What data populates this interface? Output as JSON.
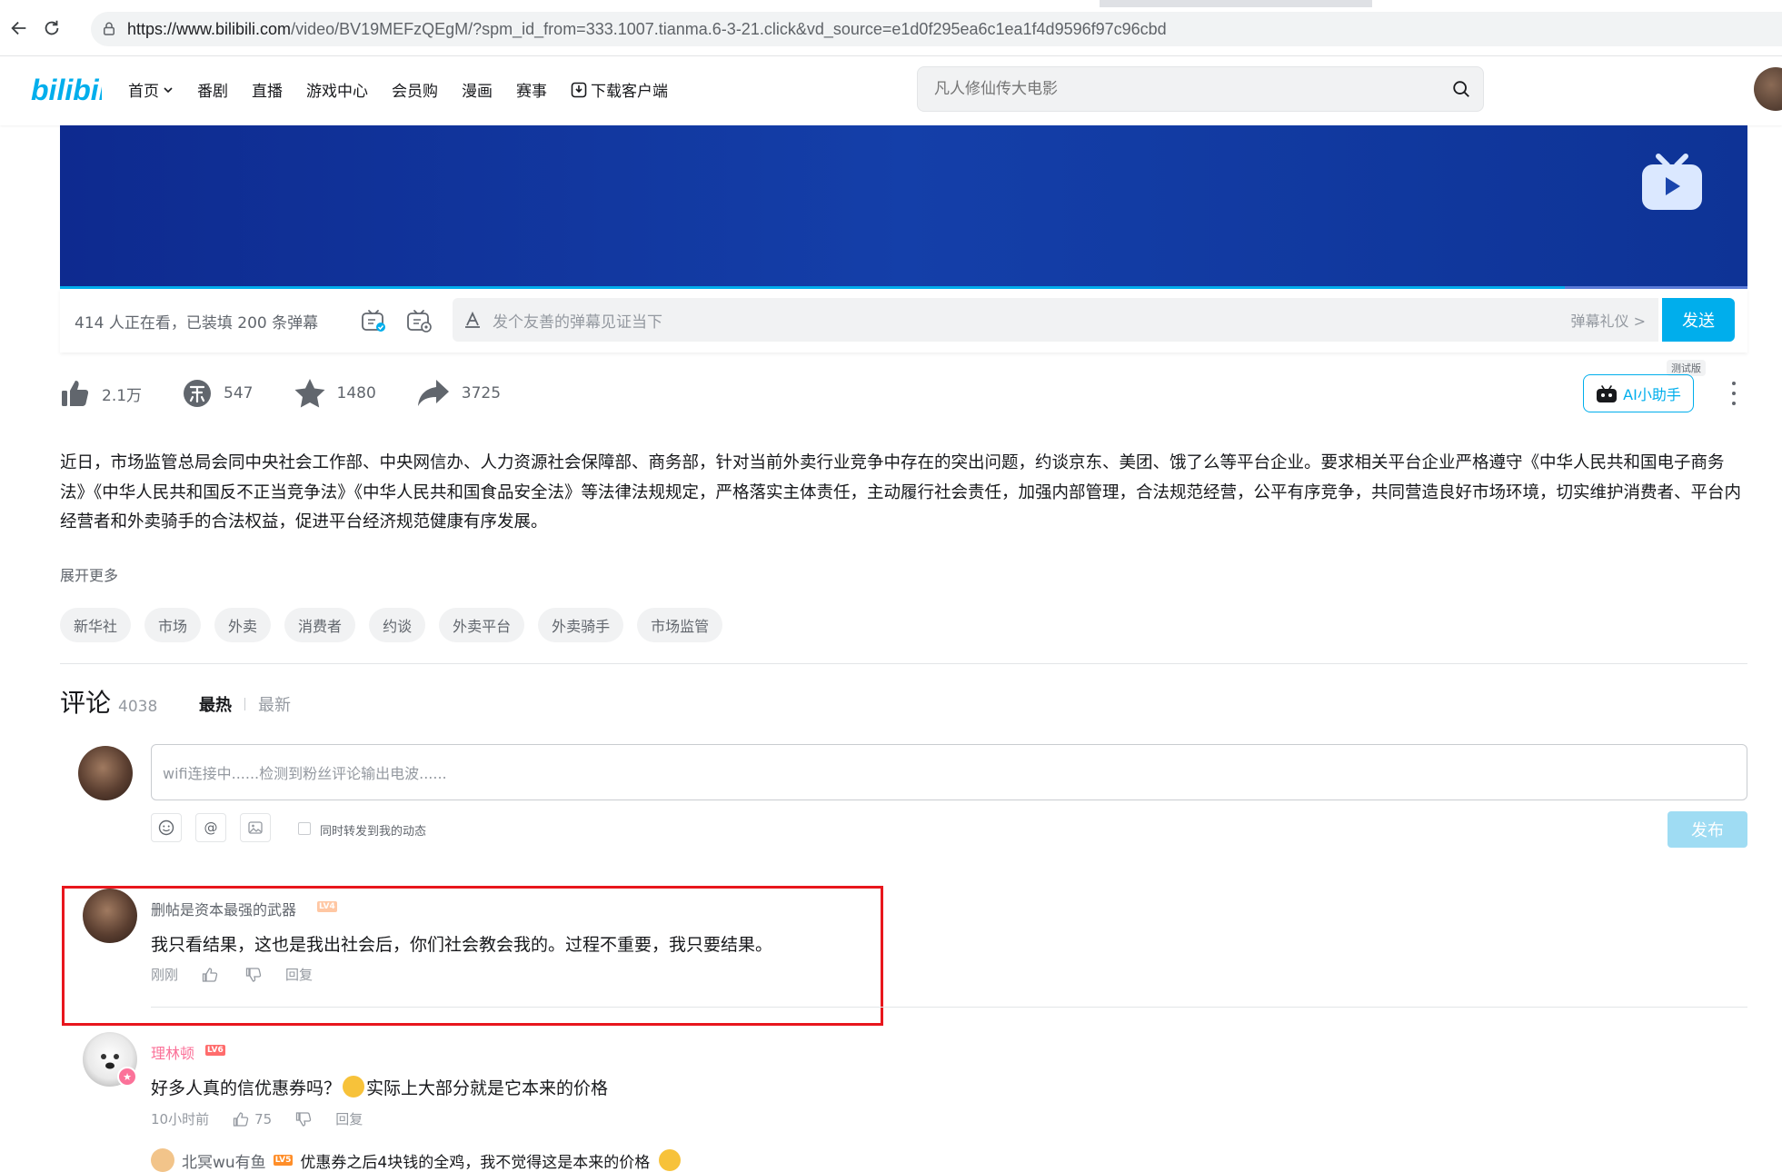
{
  "browser": {
    "url_host": "https://www.bilibili.com",
    "url_rest": "/video/BV19MEFzQEgM/?spm_id_from=333.1007.tianma.6-3-21.click&vd_source=e1d0f295ea6c1ea1f4d9596f97c96cbd"
  },
  "header": {
    "logo_text": "bilibili",
    "nav": [
      "首页",
      "番剧",
      "直播",
      "游戏中心",
      "会员购",
      "漫画",
      "赛事",
      "下载客户端"
    ],
    "search_placeholder": "凡人修仙传大电影"
  },
  "player": {
    "viewer_info": "414 人正在看，已装填 200 条弹幕",
    "danmaku_placeholder": "发个友善的弹幕见证当下",
    "etiquette": "弹幕礼仪 >",
    "send_label": "发送",
    "progress_fraction": 0.892
  },
  "actions": {
    "like": "2.1万",
    "coin": "547",
    "favorite": "1480",
    "share": "3725",
    "ai_label": "AI小助手",
    "ai_badge": "测试版"
  },
  "description": {
    "text": "近日，市场监管总局会同中央社会工作部、中央网信办、人力资源社会保障部、商务部，针对当前外卖行业竞争中存在的突出问题，约谈京东、美团、饿了么等平台企业。要求相关平台企业严格遵守《中华人民共和国电子商务法》《中华人民共和国反不正当竞争法》《中华人民共和国食品安全法》等法律法规规定，严格落实主体责任，主动履行社会责任，加强内部管理，合法规范经营，公平有序竞争，共同营造良好市场环境，切实维护消费者、平台内经营者和外卖骑手的合法权益，促进平台经济规范健康有序发展。",
    "expand_label": "展开更多"
  },
  "tags": [
    "新华社",
    "市场",
    "外卖",
    "消费者",
    "约谈",
    "外卖平台",
    "外卖骑手",
    "市场监管"
  ],
  "comments": {
    "title": "评论",
    "count": "4038",
    "sort_hot": "最热",
    "sort_new": "最新",
    "input_placeholder": "wifi连接中......检测到粉丝评论输出电波......",
    "forward_label": "同时转发到我的动态",
    "publish_label": "发布",
    "items": [
      {
        "user": "删帖是资本最强的武器",
        "level": "LV4",
        "text": "我只看结果，这也是我出社会后，你们社会教会我的。过程不重要，我只要结果。",
        "time": "刚刚",
        "likes": "",
        "reply_label": "回复"
      },
      {
        "user": "理林顿",
        "level": "LV6",
        "text_a": "好多人真的信优惠券吗？",
        "text_b": "实际上大部分就是它本来的价格",
        "time": "10小时前",
        "likes": "75",
        "reply_label": "回复"
      }
    ],
    "sub_reply": {
      "user": "北冥wu有鱼",
      "level": "LV5",
      "text": "优惠券之后4块钱的全鸡，我不觉得这是本来的价格"
    }
  },
  "colors": {
    "accent": "#00aeec",
    "pink": "#fb7299",
    "highlight": "#e8161d"
  }
}
